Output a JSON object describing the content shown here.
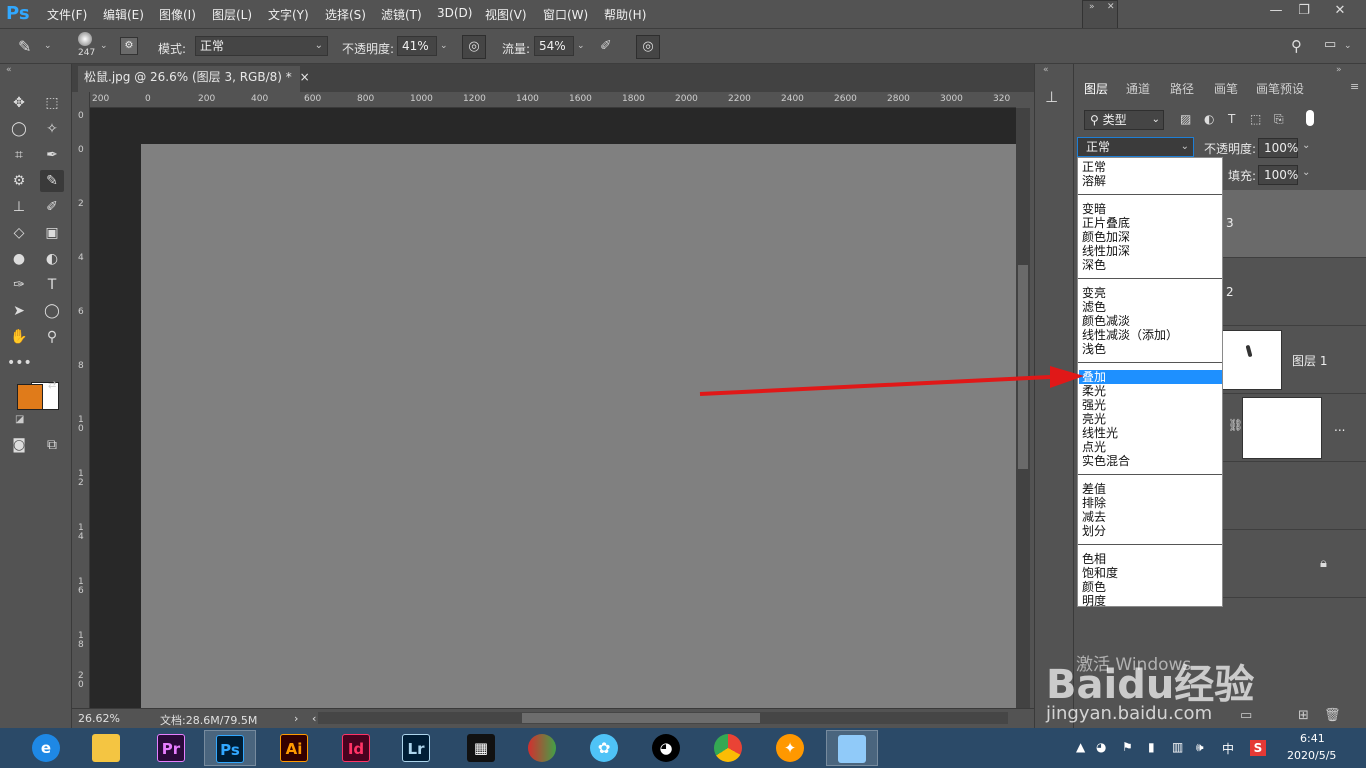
{
  "app": {
    "logo": "Ps"
  },
  "menu": [
    "文件(F)",
    "编辑(E)",
    "图像(I)",
    "图层(L)",
    "文字(Y)",
    "选择(S)",
    "滤镜(T)",
    "3D(D)",
    "视图(V)",
    "窗口(W)",
    "帮助(H)"
  ],
  "options": {
    "brush_size": "247",
    "mode_label": "模式:",
    "mode_value": "正常",
    "opacity_label": "不透明度:",
    "opacity_value": "41%",
    "flow_label": "流量:",
    "flow_value": "54%"
  },
  "document": {
    "tab_title": "松鼠.jpg @ 26.6% (图层 3, RGB/8) *",
    "zoom": "26.62%",
    "doc_info": "文档:28.6M/79.5M",
    "ruler_top": [
      "200",
      "0",
      "200",
      "400",
      "600",
      "800",
      "1000",
      "1200",
      "1400",
      "1600",
      "1800",
      "2000",
      "2200",
      "2400",
      "2600",
      "2800",
      "3000",
      "320"
    ],
    "ruler_left": [
      "0",
      "0",
      "2",
      "4",
      "6",
      "8",
      "1 0",
      "1 2",
      "1 4",
      "1 6",
      "1 8",
      "2 0"
    ]
  },
  "panel": {
    "tabs": [
      "图层",
      "通道",
      "路径",
      "画笔",
      "画笔预设"
    ],
    "filter_label": "类型",
    "opacity_label": "不透明度:",
    "opacity_value": "100%",
    "fill_label": "填充:",
    "fill_value": "100%",
    "layers": [
      {
        "name": "3"
      },
      {
        "name": "2"
      },
      {
        "name": "图层 1"
      },
      {
        "name": "..."
      }
    ]
  },
  "blend": {
    "current": "正常",
    "groups": [
      [
        "正常",
        "溶解"
      ],
      [
        "变暗",
        "正片叠底",
        "颜色加深",
        "线性加深",
        "深色"
      ],
      [
        "变亮",
        "滤色",
        "颜色减淡",
        "线性减淡（添加）",
        "浅色"
      ],
      [
        "叠加",
        "柔光",
        "强光",
        "亮光",
        "线性光",
        "点光",
        "实色混合"
      ],
      [
        "差值",
        "排除",
        "减去",
        "划分"
      ],
      [
        "色相",
        "饱和度",
        "颜色",
        "明度"
      ]
    ],
    "selected": "叠加"
  },
  "colors": {
    "foreground": "#e07b1a",
    "background": "#ffffff",
    "arrow": "#e01818",
    "selection": "#1e90ff"
  },
  "overlay": {
    "activate_text": "激活 Windows",
    "brand": "Baidu经验",
    "site": "jingyan.baidu.com"
  },
  "taskbar": {
    "apps": [
      "Pr",
      "Ps",
      "Ai",
      "Id",
      "Lr"
    ],
    "time": "6:41",
    "date": "2020/5/5",
    "ime": "中"
  }
}
